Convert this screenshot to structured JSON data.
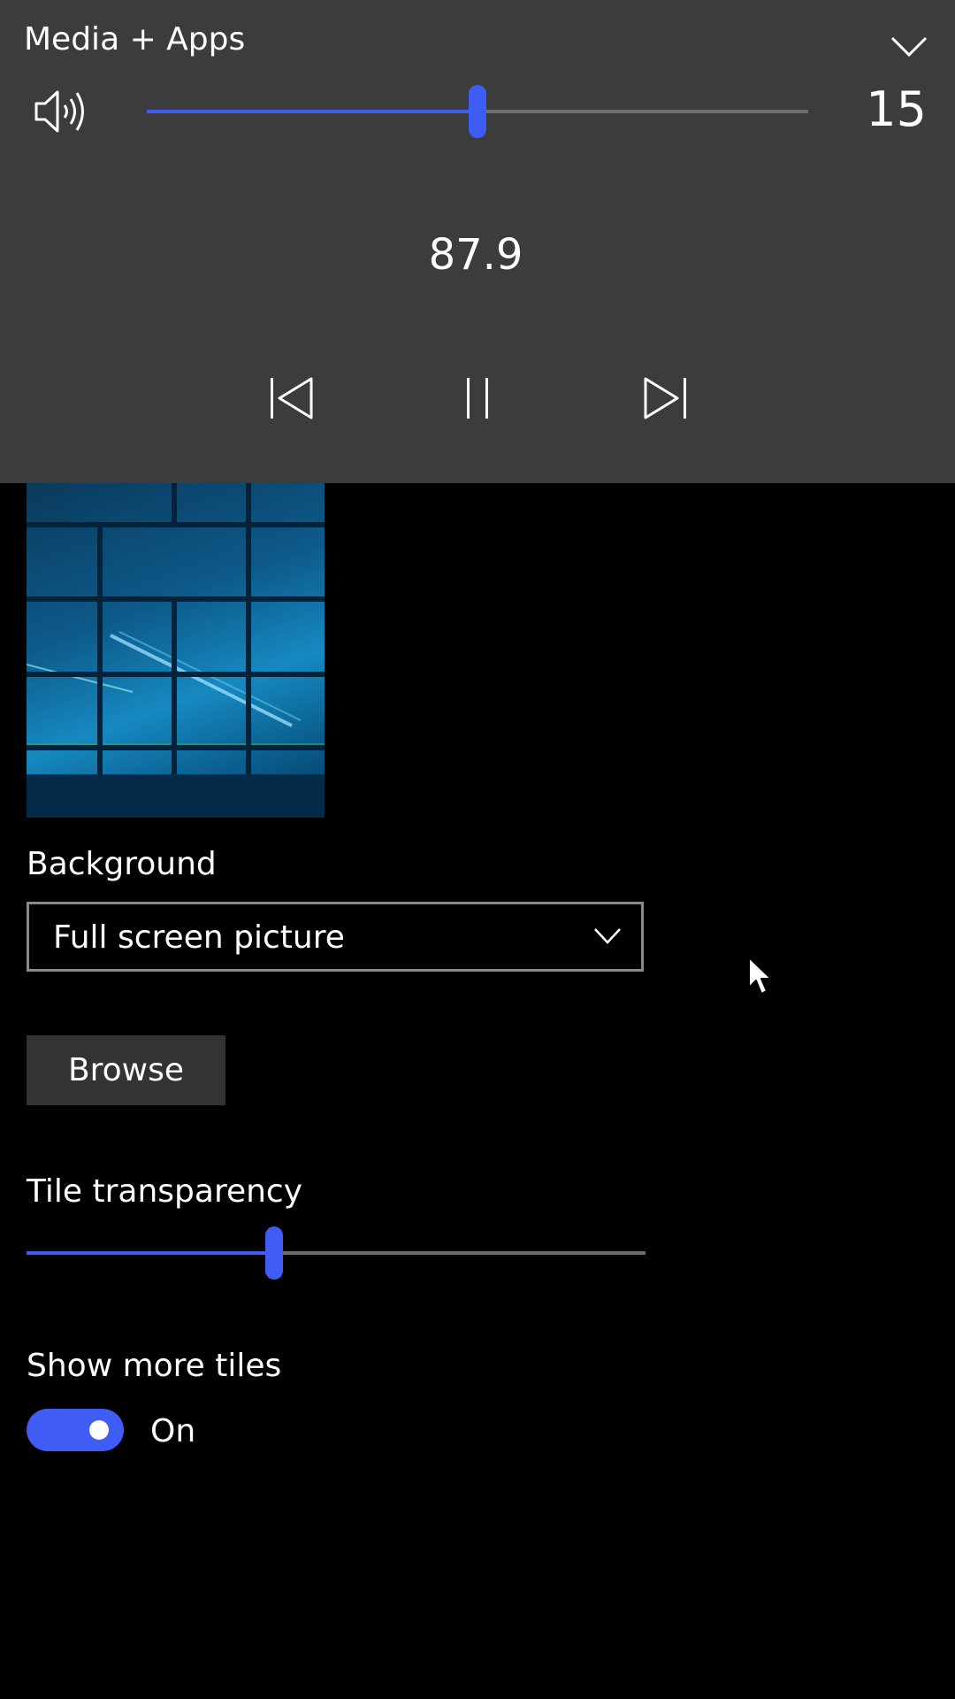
{
  "flyout": {
    "title": "Media + Apps",
    "volume_value": "15",
    "volume_level": 0.5,
    "station": "87.9",
    "icons": {
      "collapse": "chevron-down-icon",
      "speaker": "speaker-volume-icon",
      "previous": "skip-previous-icon",
      "pause": "pause-icon",
      "next": "skip-next-icon"
    }
  },
  "settings": {
    "background_label": "Background",
    "background_value": "Full screen picture",
    "browse_label": "Browse",
    "transparency_label": "Tile transparency",
    "transparency_level": 0.4,
    "show_more_tiles_label": "Show more tiles",
    "show_more_tiles_state": "On",
    "show_more_tiles_on": true
  },
  "colors": {
    "accent": "#3f5df5",
    "flyout_background": "#3c3c3c",
    "track": "#6e6e6e",
    "page_background": "#000000"
  }
}
